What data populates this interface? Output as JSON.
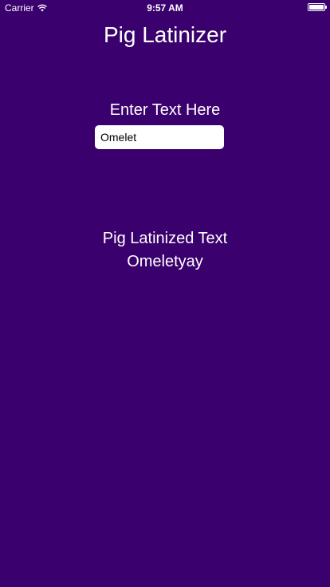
{
  "status_bar": {
    "carrier": "Carrier",
    "time": "9:57 AM",
    "wifi_icon": "wifi-icon",
    "battery_icon": "battery-icon"
  },
  "app": {
    "title": "Pig Latinizer"
  },
  "input_section": {
    "label": "Enter Text Here",
    "value": "Omelet",
    "placeholder": ""
  },
  "output_section": {
    "label": "Pig Latinized Text",
    "value": "Omeletyay"
  },
  "colors": {
    "background": "#3a006d",
    "text": "#ffffff",
    "input_background": "#ffffff",
    "caret": "#1f5bd6"
  }
}
